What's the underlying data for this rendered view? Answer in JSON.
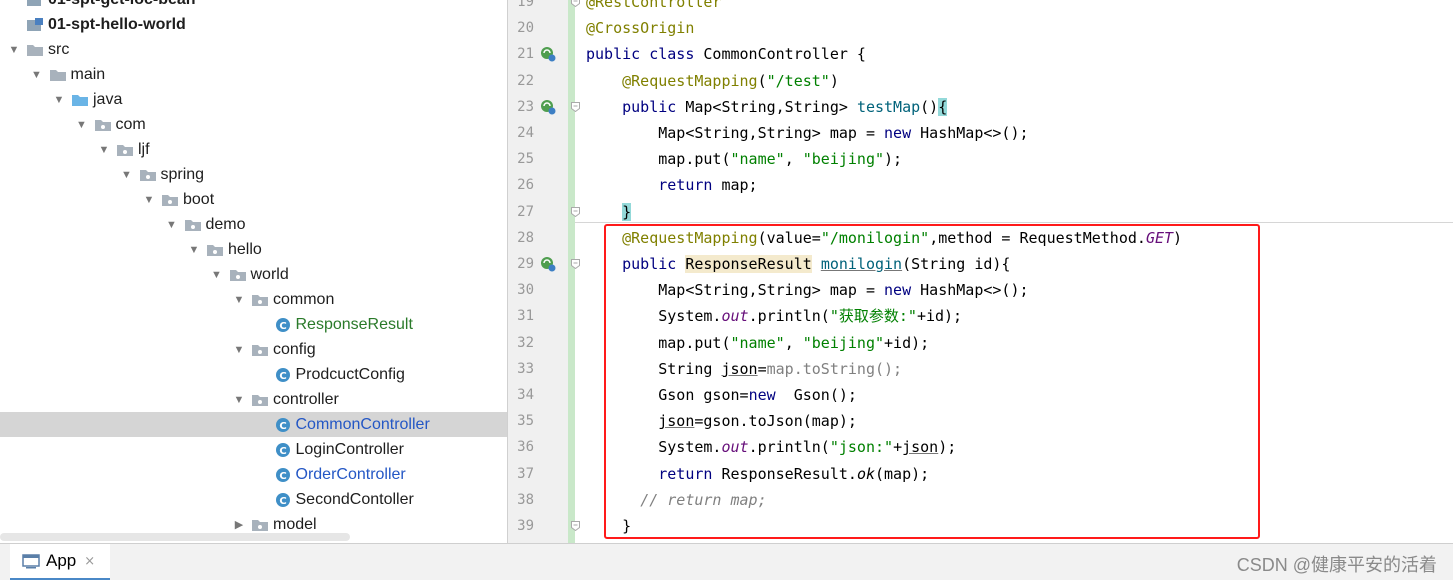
{
  "tree": {
    "items": [
      {
        "label": "01-spt-get-ioc-bean",
        "depth": 0,
        "kind": "module",
        "arrow": "none",
        "style": "bold"
      },
      {
        "label": "01-spt-hello-world",
        "depth": 0,
        "kind": "module",
        "arrow": "none",
        "style": "bold"
      },
      {
        "label": "src",
        "depth": 0,
        "kind": "folder",
        "arrow": "down"
      },
      {
        "label": "main",
        "depth": 1,
        "kind": "folder",
        "arrow": "down"
      },
      {
        "label": "java",
        "depth": 2,
        "kind": "source-folder",
        "arrow": "down"
      },
      {
        "label": "com",
        "depth": 3,
        "kind": "package",
        "arrow": "down"
      },
      {
        "label": "ljf",
        "depth": 4,
        "kind": "package",
        "arrow": "down"
      },
      {
        "label": "spring",
        "depth": 5,
        "kind": "package",
        "arrow": "down"
      },
      {
        "label": "boot",
        "depth": 6,
        "kind": "package",
        "arrow": "down"
      },
      {
        "label": "demo",
        "depth": 7,
        "kind": "package",
        "arrow": "down"
      },
      {
        "label": "hello",
        "depth": 8,
        "kind": "package",
        "arrow": "down"
      },
      {
        "label": "world",
        "depth": 9,
        "kind": "package",
        "arrow": "down"
      },
      {
        "label": "common",
        "depth": 10,
        "kind": "package",
        "arrow": "down"
      },
      {
        "label": "ResponseResult",
        "depth": 11,
        "kind": "class",
        "arrow": "none",
        "style": "green"
      },
      {
        "label": "config",
        "depth": 10,
        "kind": "package",
        "arrow": "down"
      },
      {
        "label": "ProdcuctConfig",
        "depth": 11,
        "kind": "class",
        "arrow": "none"
      },
      {
        "label": "controller",
        "depth": 10,
        "kind": "package",
        "arrow": "down"
      },
      {
        "label": "CommonController",
        "depth": 11,
        "kind": "class",
        "arrow": "none",
        "style": "blue",
        "selected": true
      },
      {
        "label": "LoginController",
        "depth": 11,
        "kind": "class",
        "arrow": "none"
      },
      {
        "label": "OrderController",
        "depth": 11,
        "kind": "class",
        "arrow": "none",
        "style": "blue"
      },
      {
        "label": "SecondContoller",
        "depth": 11,
        "kind": "class",
        "arrow": "none"
      },
      {
        "label": "model",
        "depth": 10,
        "kind": "package",
        "arrow": "right"
      }
    ]
  },
  "editor": {
    "line_numbers": [
      "19",
      "20",
      "21",
      "22",
      "23",
      "24",
      "25",
      "26",
      "27",
      "28",
      "29",
      "30",
      "31",
      "32",
      "33",
      "34",
      "35",
      "36",
      "37",
      "38",
      "39"
    ],
    "lines": [
      [
        {
          "t": "@RestController",
          "c": "ann"
        }
      ],
      [
        {
          "t": "@CrossOrigin",
          "c": "ann"
        }
      ],
      [
        {
          "t": "public class ",
          "c": "kw"
        },
        {
          "t": "CommonController {",
          "c": ""
        }
      ],
      [
        {
          "t": "    @RequestMapping",
          "c": "ann"
        },
        {
          "t": "(",
          "c": ""
        },
        {
          "t": "\"/test\"",
          "c": "str"
        },
        {
          "t": ")",
          "c": ""
        }
      ],
      [
        {
          "t": "    public ",
          "c": "kw"
        },
        {
          "t": "Map<String,String> ",
          "c": ""
        },
        {
          "t": "testMap",
          "c": "method-name"
        },
        {
          "t": "()",
          "c": ""
        },
        {
          "t": "{",
          "c": "brace-hl"
        }
      ],
      [
        {
          "t": "        Map<String,String> map = ",
          "c": ""
        },
        {
          "t": "new ",
          "c": "kw"
        },
        {
          "t": "HashMap<>();",
          "c": ""
        }
      ],
      [
        {
          "t": "        map.put(",
          "c": ""
        },
        {
          "t": "\"name\"",
          "c": "str"
        },
        {
          "t": ", ",
          "c": ""
        },
        {
          "t": "\"beijing\"",
          "c": "str"
        },
        {
          "t": ");",
          "c": ""
        }
      ],
      [
        {
          "t": "        ",
          "c": ""
        },
        {
          "t": "return ",
          "c": "kw"
        },
        {
          "t": "map;",
          "c": ""
        }
      ],
      [
        {
          "t": "    ",
          "c": ""
        },
        {
          "t": "}",
          "c": "brace-hl"
        }
      ],
      [
        {
          "t": "    @RequestMapping",
          "c": "ann"
        },
        {
          "t": "(value=",
          "c": ""
        },
        {
          "t": "\"/monilogin\"",
          "c": "str"
        },
        {
          "t": ",method = RequestMethod.",
          "c": ""
        },
        {
          "t": "GET",
          "c": "stat"
        },
        {
          "t": ")",
          "c": ""
        }
      ],
      [
        {
          "t": "    public ",
          "c": "kw"
        },
        {
          "t": "ResponseResult",
          "c": "hl-type"
        },
        {
          "t": " ",
          "c": ""
        },
        {
          "t": "monilogin",
          "c": "method-name u"
        },
        {
          "t": "(String id){",
          "c": ""
        }
      ],
      [
        {
          "t": "        Map<String,String> map = ",
          "c": ""
        },
        {
          "t": "new ",
          "c": "kw"
        },
        {
          "t": "HashMap<>();",
          "c": ""
        }
      ],
      [
        {
          "t": "        System.",
          "c": ""
        },
        {
          "t": "out",
          "c": "stat"
        },
        {
          "t": ".println(",
          "c": ""
        },
        {
          "t": "\"获取参数:\"",
          "c": "str"
        },
        {
          "t": "+id);",
          "c": ""
        }
      ],
      [
        {
          "t": "        map.put(",
          "c": ""
        },
        {
          "t": "\"name\"",
          "c": "str"
        },
        {
          "t": ", ",
          "c": ""
        },
        {
          "t": "\"beijing\"",
          "c": "str"
        },
        {
          "t": "+id);",
          "c": ""
        }
      ],
      [
        {
          "t": "        String ",
          "c": ""
        },
        {
          "t": "json",
          "c": "u"
        },
        {
          "t": "=",
          "c": ""
        },
        {
          "t": "map.toString();",
          "c": "grey"
        }
      ],
      [
        {
          "t": "        Gson gson=",
          "c": ""
        },
        {
          "t": "new ",
          "c": "kw"
        },
        {
          "t": " Gson();",
          "c": ""
        }
      ],
      [
        {
          "t": "        ",
          "c": ""
        },
        {
          "t": "json",
          "c": "u"
        },
        {
          "t": "=gson.toJson(map);",
          "c": ""
        }
      ],
      [
        {
          "t": "        System.",
          "c": ""
        },
        {
          "t": "out",
          "c": "stat"
        },
        {
          "t": ".println(",
          "c": ""
        },
        {
          "t": "\"json:\"",
          "c": "str"
        },
        {
          "t": "+",
          "c": ""
        },
        {
          "t": "json",
          "c": "u"
        },
        {
          "t": ");",
          "c": ""
        }
      ],
      [
        {
          "t": "        ",
          "c": ""
        },
        {
          "t": "return ",
          "c": "kw"
        },
        {
          "t": "ResponseResult.",
          "c": ""
        },
        {
          "t": "ok",
          "c": "call"
        },
        {
          "t": "(map);",
          "c": ""
        }
      ],
      [
        {
          "t": "      ",
          "c": ""
        },
        {
          "t": "// return map;",
          "c": "cmt"
        }
      ],
      [
        {
          "t": "    }",
          "c": ""
        }
      ]
    ],
    "gutter_icons": {
      "21": "bean-icon",
      "23": "bean-icon",
      "29": "bean-icon"
    },
    "fold_markers": [
      "19",
      "23",
      "27",
      "29",
      "39"
    ]
  },
  "bottom_bar": {
    "tab_label": "App",
    "tab_close": "×",
    "watermark": "CSDN @健康平安的活着"
  }
}
